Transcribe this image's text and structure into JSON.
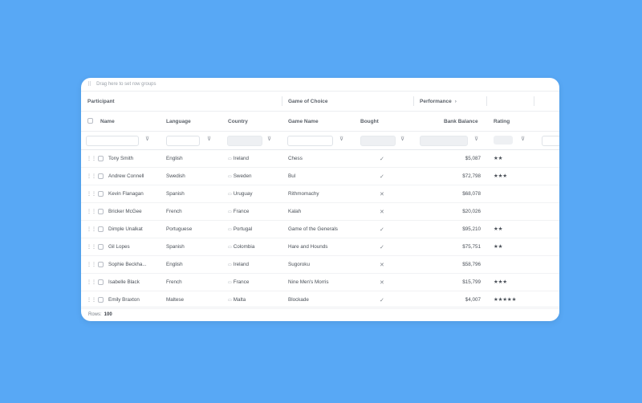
{
  "group_panel": {
    "placeholder": "Drag here to set row groups"
  },
  "group_headers": {
    "participant": "Participant",
    "game": "Game of Choice",
    "performance": "Performance",
    "performance_chevron": "›"
  },
  "columns": {
    "name": "Name",
    "language": "Language",
    "country": "Country",
    "game_name": "Game Name",
    "bought": "Bought",
    "bank_balance": "Bank Balance",
    "rating": "Rating"
  },
  "filter_icon": "⊽",
  "rows": [
    {
      "name": "Tony Smith",
      "language": "English",
      "country": "Ireland",
      "game": "Chess",
      "bought": "✓",
      "balance": "$5,087",
      "rating": "★★"
    },
    {
      "name": "Andrew Connell",
      "language": "Swedish",
      "country": "Sweden",
      "game": "Bul",
      "bought": "✓",
      "balance": "$72,798",
      "rating": "★★★"
    },
    {
      "name": "Kevin Flanagan",
      "language": "Spanish",
      "country": "Uruguay",
      "game": "Rithmomachy",
      "bought": "✕",
      "balance": "$68,078",
      "rating": ""
    },
    {
      "name": "Bricker McGee",
      "language": "French",
      "country": "France",
      "game": "Kalah",
      "bought": "✕",
      "balance": "$20,026",
      "rating": ""
    },
    {
      "name": "Dimple Unalkat",
      "language": "Portuguese",
      "country": "Portugal",
      "game": "Game of the Generals",
      "bought": "✓",
      "balance": "$95,210",
      "rating": "★★"
    },
    {
      "name": "Gil Lopes",
      "language": "Spanish",
      "country": "Colombia",
      "game": "Hare and Hounds",
      "bought": "✓",
      "balance": "$75,751",
      "rating": "★★"
    },
    {
      "name": "Sophie Beckha...",
      "language": "English",
      "country": "Ireland",
      "game": "Sugoroku",
      "bought": "✕",
      "balance": "$58,796",
      "rating": ""
    },
    {
      "name": "Isabelle Black",
      "language": "French",
      "country": "France",
      "game": "Nine Men's Morris",
      "bought": "✕",
      "balance": "$15,799",
      "rating": "★★★"
    },
    {
      "name": "Emily Braxton",
      "language": "Maltese",
      "country": "Malta",
      "game": "Blockade",
      "bought": "✓",
      "balance": "$4,007",
      "rating": "★★★★★"
    }
  ],
  "footer": {
    "label": "Rows:",
    "count": "100"
  }
}
